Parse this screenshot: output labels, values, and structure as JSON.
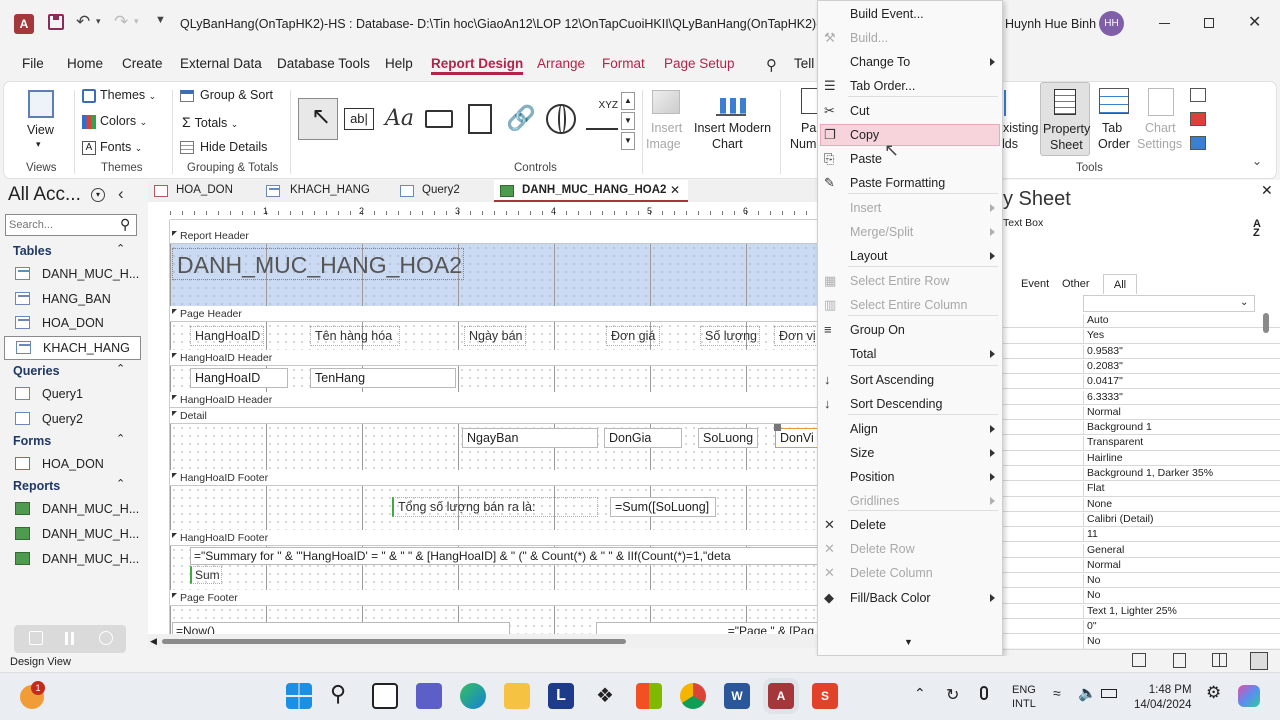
{
  "titlebar": {
    "window_title": "QLyBanHang(OnTapHK2)-HS : Database- D:\\Tin hoc\\GiaoAn12\\LOP 12\\OnTapCuoiHKII\\QLyBanHang(OnTapHK2)-HS.accd",
    "user_name": "Huynh Hue Binh",
    "user_initials": "HH"
  },
  "menus": [
    "File",
    "Home",
    "Create",
    "External Data",
    "Database Tools",
    "Help",
    "Report Design",
    "Arrange",
    "Format",
    "Page Setup"
  ],
  "tell_me": "Tell",
  "ribbon": {
    "view": "View",
    "views_label": "Views",
    "themes": "Themes",
    "colors": "Colors",
    "fonts": "Fonts",
    "themes_label": "Themes",
    "group_sort": "Group & Sort",
    "totals": "Totals",
    "hide_details": "Hide Details",
    "grouping_label": "Grouping & Totals",
    "controls_label": "Controls",
    "insert_image_1": "Insert",
    "insert_image_2": "Image",
    "insert_chart_1": "Insert Modern",
    "insert_chart_2": "Chart",
    "page_num_1": "Pa",
    "page_num_2": "Num",
    "existing_1": "xisting",
    "existing_2": "lds",
    "property_sheet_1": "Property",
    "property_sheet_2": "Sheet",
    "tab_order_1": "Tab",
    "tab_order_2": "Order",
    "chart_settings_1": "Chart",
    "chart_settings_2": "Settings",
    "tools_label": "Tools",
    "aa": "Aa",
    "abl": "ab|",
    "xyz": "XYZ"
  },
  "nav": {
    "title": "All Acc...",
    "search_placeholder": "Search...",
    "tables_label": "Tables",
    "tables": [
      "DANH_MUC_H...",
      "HANG_BAN",
      "HOA_DON",
      "KHACH_HANG"
    ],
    "queries_label": "Queries",
    "queries": [
      "Query1",
      "Query2"
    ],
    "forms_label": "Forms",
    "forms": [
      "HOA_DON"
    ],
    "reports_label": "Reports",
    "reports": [
      "DANH_MUC_H...",
      "DANH_MUC_H...",
      "DANH_MUC_H..."
    ]
  },
  "doc_tabs": [
    "HOA_DON",
    "KHACH_HANG",
    "Query2",
    "DANH_MUC_HANG_HOA2"
  ],
  "ruler_marks": [
    "1",
    "2",
    "3",
    "4",
    "5",
    "6"
  ],
  "report": {
    "report_header": "Report Header",
    "title": "DANH_MUC_HANG_HOA2",
    "page_header": "Page Header",
    "col_labels": [
      "HangHoaID",
      "Tên hàng hóa",
      "Ngày bán",
      "Đơn giá",
      "Số lượng",
      "Đơn vị"
    ],
    "group_header_1": "HangHoaID Header",
    "gh_fields": [
      "HangHoaID",
      "TenHang"
    ],
    "group_header_2": "HangHoaID Header",
    "detail": "Detail",
    "detail_fields": [
      "NgayBan",
      "DonGia",
      "SoLuong",
      "DonVi"
    ],
    "group_footer_1": "HangHoaID Footer",
    "gf_label": "Tổng số lượng bán ra là:",
    "gf_expr": "=Sum([SoLuong]",
    "group_footer_2": "HangHoaID Footer",
    "summary_expr": "=\"Summary for \" & \"'HangHoaID' = \" & \" \" & [HangHoaID] & \" (\" & Count(*) & \" \" & IIf(Count(*)=1,\"deta",
    "sum_label": "Sum",
    "page_footer": "Page Footer",
    "now_expr": "=Now()",
    "page_expr": "=\"Page \" & [Pag"
  },
  "context_menu": [
    {
      "label": "Build Event...",
      "enabled": true,
      "arrow": false,
      "icon": ""
    },
    {
      "label": "Build...",
      "enabled": false,
      "arrow": false,
      "icon": "build-icon"
    },
    {
      "label": "Change To",
      "enabled": true,
      "arrow": true,
      "icon": ""
    },
    {
      "label": "Tab Order...",
      "enabled": true,
      "arrow": false,
      "icon": "tab-order-icon"
    },
    {
      "label": "Cut",
      "enabled": true,
      "arrow": false,
      "icon": "cut-icon"
    },
    {
      "label": "Copy",
      "enabled": true,
      "arrow": false,
      "icon": "copy-icon"
    },
    {
      "label": "Paste",
      "enabled": true,
      "arrow": false,
      "icon": "paste-icon"
    },
    {
      "label": "Paste Formatting",
      "enabled": true,
      "arrow": false,
      "icon": "paste-formatting-icon"
    },
    {
      "label": "Insert",
      "enabled": false,
      "arrow": true,
      "icon": ""
    },
    {
      "label": "Merge/Split",
      "enabled": false,
      "arrow": true,
      "icon": ""
    },
    {
      "label": "Layout",
      "enabled": true,
      "arrow": true,
      "icon": ""
    },
    {
      "label": "Select Entire Row",
      "enabled": false,
      "arrow": false,
      "icon": "select-row-icon"
    },
    {
      "label": "Select Entire Column",
      "enabled": false,
      "arrow": false,
      "icon": "select-column-icon"
    },
    {
      "label": "Group On",
      "enabled": true,
      "arrow": false,
      "icon": "group-on-icon"
    },
    {
      "label": "Total",
      "enabled": true,
      "arrow": true,
      "icon": ""
    },
    {
      "label": "Sort Ascending",
      "enabled": true,
      "arrow": false,
      "icon": "sort-ascending-icon"
    },
    {
      "label": "Sort Descending",
      "enabled": true,
      "arrow": false,
      "icon": "sort-descending-icon"
    },
    {
      "label": "Align",
      "enabled": true,
      "arrow": true,
      "icon": ""
    },
    {
      "label": "Size",
      "enabled": true,
      "arrow": true,
      "icon": ""
    },
    {
      "label": "Position",
      "enabled": true,
      "arrow": true,
      "icon": ""
    },
    {
      "label": "Gridlines",
      "enabled": false,
      "arrow": true,
      "icon": ""
    },
    {
      "label": "Delete",
      "enabled": true,
      "arrow": false,
      "icon": "delete-icon"
    },
    {
      "label": "Delete Row",
      "enabled": false,
      "arrow": false,
      "icon": "delete-row-icon"
    },
    {
      "label": "Delete Column",
      "enabled": false,
      "arrow": false,
      "icon": "delete-column-icon"
    },
    {
      "label": "Fill/Back Color",
      "enabled": true,
      "arrow": true,
      "icon": "fill-color-icon"
    }
  ],
  "property_sheet": {
    "title": "y Sheet",
    "selection_type": "Text Box",
    "tabs": [
      "Event",
      "Other",
      "All"
    ],
    "values": [
      "Auto",
      "Yes",
      "0.9583\"",
      "0.2083\"",
      "0.0417\"",
      "6.3333\"",
      "Normal",
      "Background 1",
      "Transparent",
      "Hairline",
      "Background 1, Darker 35%",
      "Flat",
      "None",
      "Calibri (Detail)",
      "11",
      "General",
      "Normal",
      "No",
      "No",
      "Text 1, Lighter 25%",
      "0\"",
      "No"
    ]
  },
  "statusbar": {
    "text": "Design View"
  },
  "taskbar": {
    "lang_1": "ENG",
    "lang_2": "INTL",
    "time": "1:48 PM",
    "date": "14/04/2024",
    "notif_count": "1"
  },
  "colors": {
    "accent_access": "#a4373a",
    "context_tab": "#b4234a",
    "copy_highlight": "#f7d4dc",
    "selection_blue": "#c9daf2"
  }
}
